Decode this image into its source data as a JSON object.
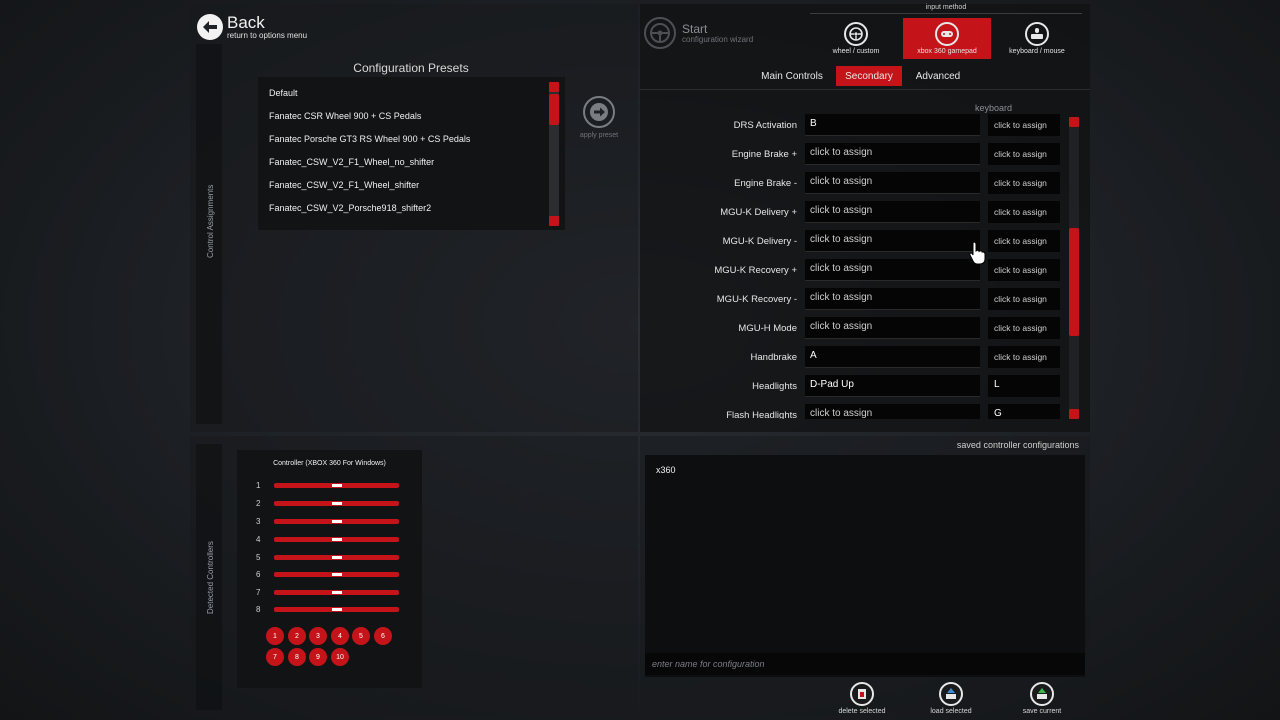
{
  "back": {
    "title": "Back",
    "subtitle": "return to options menu"
  },
  "side_labels": {
    "top": "Control Assignments",
    "bottom": "Detected Controllers"
  },
  "presets": {
    "title": "Configuration Presets",
    "items": [
      "Default",
      "Fanatec CSR Wheel 900 + CS Pedals",
      "Fanatec Porsche GT3 RS Wheel 900 + CS Pedals",
      "Fanatec_CSW_V2_F1_Wheel_no_shifter",
      "Fanatec_CSW_V2_F1_Wheel_shifter",
      "Fanatec_CSW_V2_Porsche918_shifter2"
    ],
    "apply_label": "apply preset"
  },
  "start": {
    "title": "Start",
    "subtitle": "configuration wizard"
  },
  "input_method": {
    "label": "input method",
    "options": [
      {
        "label": "wheel / custom",
        "icon": "steering-wheel-icon",
        "active": false
      },
      {
        "label": "xbox 360 gamepad",
        "icon": "gamepad-icon",
        "active": true
      },
      {
        "label": "keyboard / mouse",
        "icon": "keyboard-mouse-icon",
        "active": false
      }
    ]
  },
  "tabs": [
    {
      "label": "Main Controls",
      "active": false
    },
    {
      "label": "Secondary",
      "active": true
    },
    {
      "label": "Advanced",
      "active": false
    }
  ],
  "bindings": {
    "keyboard_header": "keyboard",
    "rows": [
      {
        "label": "DRS Activation",
        "pad": "B",
        "kb": "click to assign"
      },
      {
        "label": "Engine Brake +",
        "pad": "click to assign",
        "kb": "click to assign"
      },
      {
        "label": "Engine Brake -",
        "pad": "click to assign",
        "kb": "click to assign"
      },
      {
        "label": "MGU-K Delivery +",
        "pad": "click to assign",
        "kb": "click to assign"
      },
      {
        "label": "MGU-K Delivery -",
        "pad": "click to assign",
        "kb": "click to assign"
      },
      {
        "label": "MGU-K Recovery +",
        "pad": "click to assign",
        "kb": "click to assign"
      },
      {
        "label": "MGU-K Recovery -",
        "pad": "click to assign",
        "kb": "click to assign"
      },
      {
        "label": "MGU-H Mode",
        "pad": "click to assign",
        "kb": "click to assign"
      },
      {
        "label": "Handbrake",
        "pad": "A",
        "kb": "click to assign"
      },
      {
        "label": "Headlights",
        "pad": "D-Pad Up",
        "kb": "L"
      },
      {
        "label": "Flash Headlights",
        "pad": "click to assign",
        "kb": "G"
      }
    ]
  },
  "controller": {
    "title": "Controller (XBOX 360 For Windows)",
    "axes": [
      "1",
      "2",
      "3",
      "4",
      "5",
      "6",
      "7",
      "8"
    ],
    "buttons": [
      "1",
      "2",
      "3",
      "4",
      "5",
      "6",
      "7",
      "8",
      "9",
      "10"
    ]
  },
  "saved": {
    "title": "saved controller configurations",
    "items": [
      "x360"
    ],
    "name_placeholder": "enter name for configuration",
    "actions": [
      {
        "label": "delete selected",
        "icon": "delete-icon"
      },
      {
        "label": "load selected",
        "icon": "load-icon"
      },
      {
        "label": "save current",
        "icon": "save-icon"
      }
    ]
  },
  "colors": {
    "accent": "#c4141a",
    "panel_dark": "#121315"
  }
}
